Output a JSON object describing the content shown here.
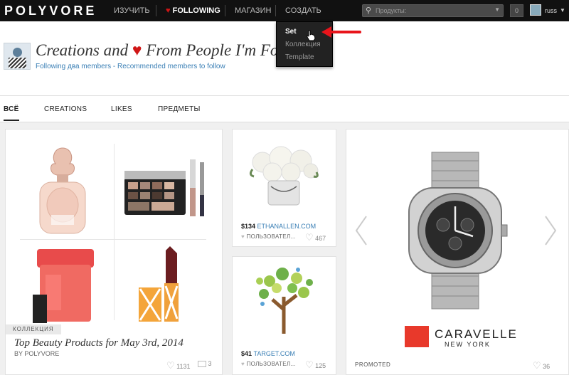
{
  "nav": {
    "logo": "POLYVORE",
    "explore": "ИЗУЧИТЬ",
    "following": "FOLLOWING",
    "shop": "МАГАЗИН",
    "create": "СОЗДАТЬ",
    "search_placeholder": "Продукты:",
    "notification_count": "0",
    "username": "russ"
  },
  "dropdown": {
    "items": [
      "Set",
      "Коллекция",
      "Template"
    ]
  },
  "header": {
    "title_before": "Creations and",
    "title_after": "From People I'm Following",
    "following_link": "Following два members",
    "separator": "-",
    "recommended_link": "Recommended members to follow"
  },
  "tabs": [
    "ВСЁ",
    "CREATIONS",
    "LIKES",
    "ПРЕДМЕТЫ"
  ],
  "cards": {
    "set": {
      "badge": "КОЛЛЕКЦИЯ",
      "title": "Top Beauty Products for May 3rd, 2014",
      "byline": "BY POLYVORE",
      "likes": "1131",
      "comments": "3"
    },
    "flowers": {
      "price": "$134",
      "store": "ETHANALLEN.COM",
      "user": "ПОЛЬЗОВАТЕЛ...",
      "likes": "467"
    },
    "tree": {
      "price": "$41",
      "store": "TARGET.COM",
      "user": "ПОЛЬЗОВАТЕЛ...",
      "likes": "125"
    },
    "promo": {
      "label": "PROMOTED",
      "brand": "CARAVELLE",
      "brand_sub": "NEW YORK",
      "likes": "36"
    }
  },
  "colors": {
    "topbar": "#111111",
    "link": "#3a7fb5",
    "heart": "#d01616",
    "arrow": "#e8141b",
    "brand_red": "#e8392b"
  }
}
